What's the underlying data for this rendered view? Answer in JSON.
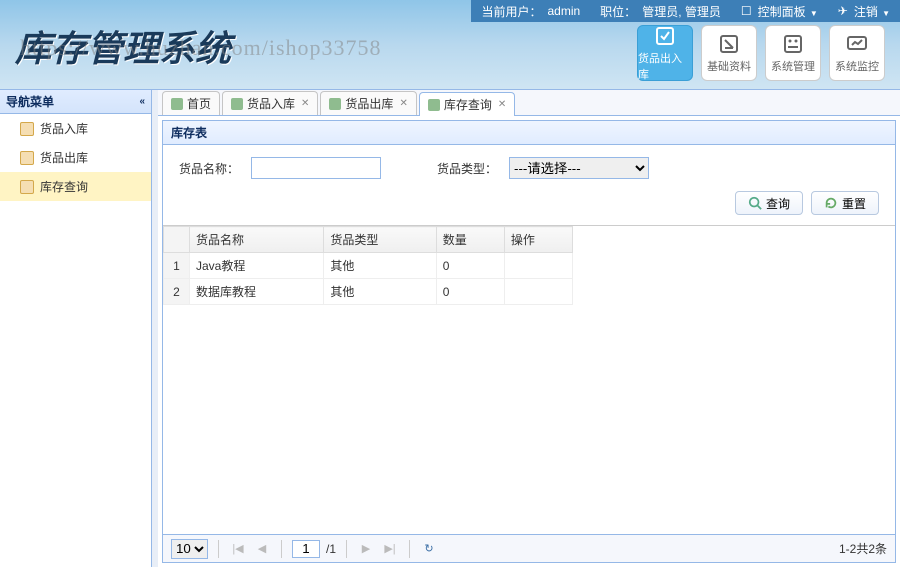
{
  "topbar": {
    "current_user_label": "当前用户：",
    "current_user": "admin",
    "role_label": "职位：",
    "role": "管理员, 管理员",
    "control_panel": "控制面板",
    "logout": "注销"
  },
  "logo": "库存管理系统",
  "watermark": "https://www.huzhan.com/ishop33758",
  "nav": [
    {
      "label": "货品出入库",
      "active": true
    },
    {
      "label": "基础资料",
      "active": false
    },
    {
      "label": "系统管理",
      "active": false
    },
    {
      "label": "系统监控",
      "active": false
    }
  ],
  "sidebar": {
    "title": "导航菜单",
    "items": [
      {
        "label": "货品入库",
        "selected": false
      },
      {
        "label": "货品出库",
        "selected": false
      },
      {
        "label": "库存查询",
        "selected": true
      }
    ]
  },
  "tabs": [
    {
      "label": "首页",
      "closable": false,
      "active": false
    },
    {
      "label": "货品入库",
      "closable": true,
      "active": false
    },
    {
      "label": "货品出库",
      "closable": true,
      "active": false
    },
    {
      "label": "库存查询",
      "closable": true,
      "active": true
    }
  ],
  "panel": {
    "title": "库存表",
    "filter": {
      "name_label": "货品名称：",
      "name_value": "",
      "type_label": "货品类型：",
      "type_placeholder": "---请选择---"
    },
    "buttons": {
      "search": "查询",
      "reset": "重置"
    }
  },
  "grid": {
    "columns": [
      "货品名称",
      "货品类型",
      "数量",
      "操作"
    ],
    "rows": [
      {
        "n": "1",
        "name": "Java教程",
        "type": "其他",
        "qty": "0",
        "op": ""
      },
      {
        "n": "2",
        "name": "数据库教程",
        "type": "其他",
        "qty": "0",
        "op": ""
      }
    ]
  },
  "pager": {
    "page_size": "10",
    "page": "1",
    "total_pages": "/1",
    "info": "1-2共2条"
  }
}
